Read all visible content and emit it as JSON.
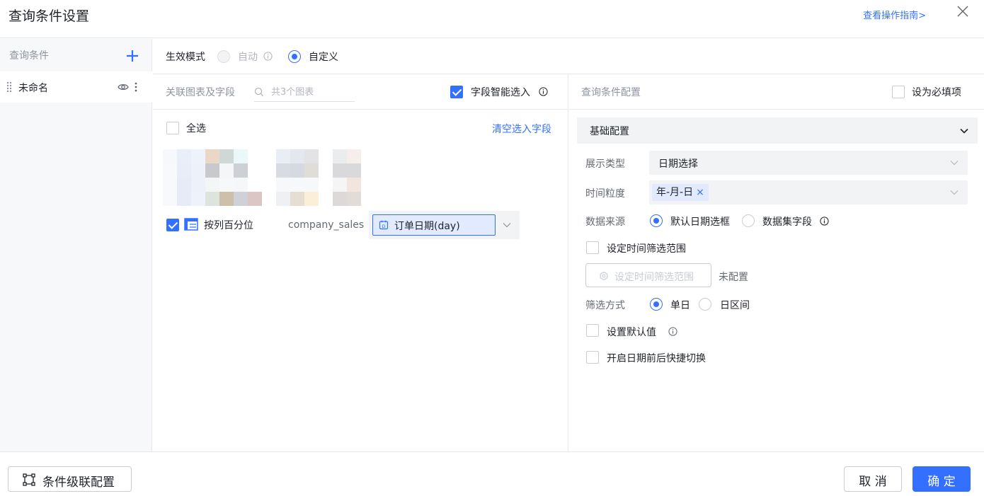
{
  "dialog": {
    "title": "查询条件设置",
    "guide_link": "查看操作指南>"
  },
  "sidebar": {
    "title": "查询条件",
    "items": [
      {
        "label": "未命名"
      }
    ]
  },
  "mode": {
    "label": "生效模式",
    "options": [
      {
        "label": "自动",
        "selected": false,
        "disabled": true
      },
      {
        "label": "自定义",
        "selected": true,
        "disabled": false
      }
    ]
  },
  "linked": {
    "title": "关联图表及字段",
    "search_placeholder": "共3个图表",
    "smart_select_label": "字段智能选入",
    "smart_select_checked": true,
    "select_all_label": "全选",
    "select_all_checked": false,
    "clear_link": "清空选入字段",
    "chart_row": {
      "checked": true,
      "chart_name": "按列百分位",
      "dataset": "company_sales",
      "field": "订单日期(day)"
    }
  },
  "config": {
    "title": "查询条件配置",
    "required_label": "设为必填项",
    "required_checked": false,
    "section_title": "基础配置",
    "display_type": {
      "label": "展示类型",
      "value": "日期选择"
    },
    "granularity": {
      "label": "时间粒度",
      "tag": "年-月-日",
      "tag_remove": "×"
    },
    "data_source": {
      "label": "数据来源",
      "options": [
        {
          "label": "默认日期选框",
          "selected": true
        },
        {
          "label": "数据集字段",
          "selected": false
        }
      ]
    },
    "time_range": {
      "checkbox_label": "设定时间筛选范围",
      "checked": false,
      "button_label": "设定时间筛选范围",
      "status": "未配置"
    },
    "filter_mode": {
      "label": "筛选方式",
      "options": [
        {
          "label": "单日",
          "selected": true
        },
        {
          "label": "日区间",
          "selected": false
        }
      ]
    },
    "default_value": {
      "label": "设置默认值",
      "checked": false
    },
    "quick_switch": {
      "label": "开启日期前后快捷切换",
      "checked": false
    }
  },
  "footer": {
    "linkage_button": "条件级联配置",
    "cancel_button": "取 消",
    "ok_button": "确 定"
  },
  "colors": {
    "accent": "#3370ff",
    "border": "#e6e8eb",
    "muted_text": "#8f959e",
    "panel_bg": "#f7f8fa"
  }
}
